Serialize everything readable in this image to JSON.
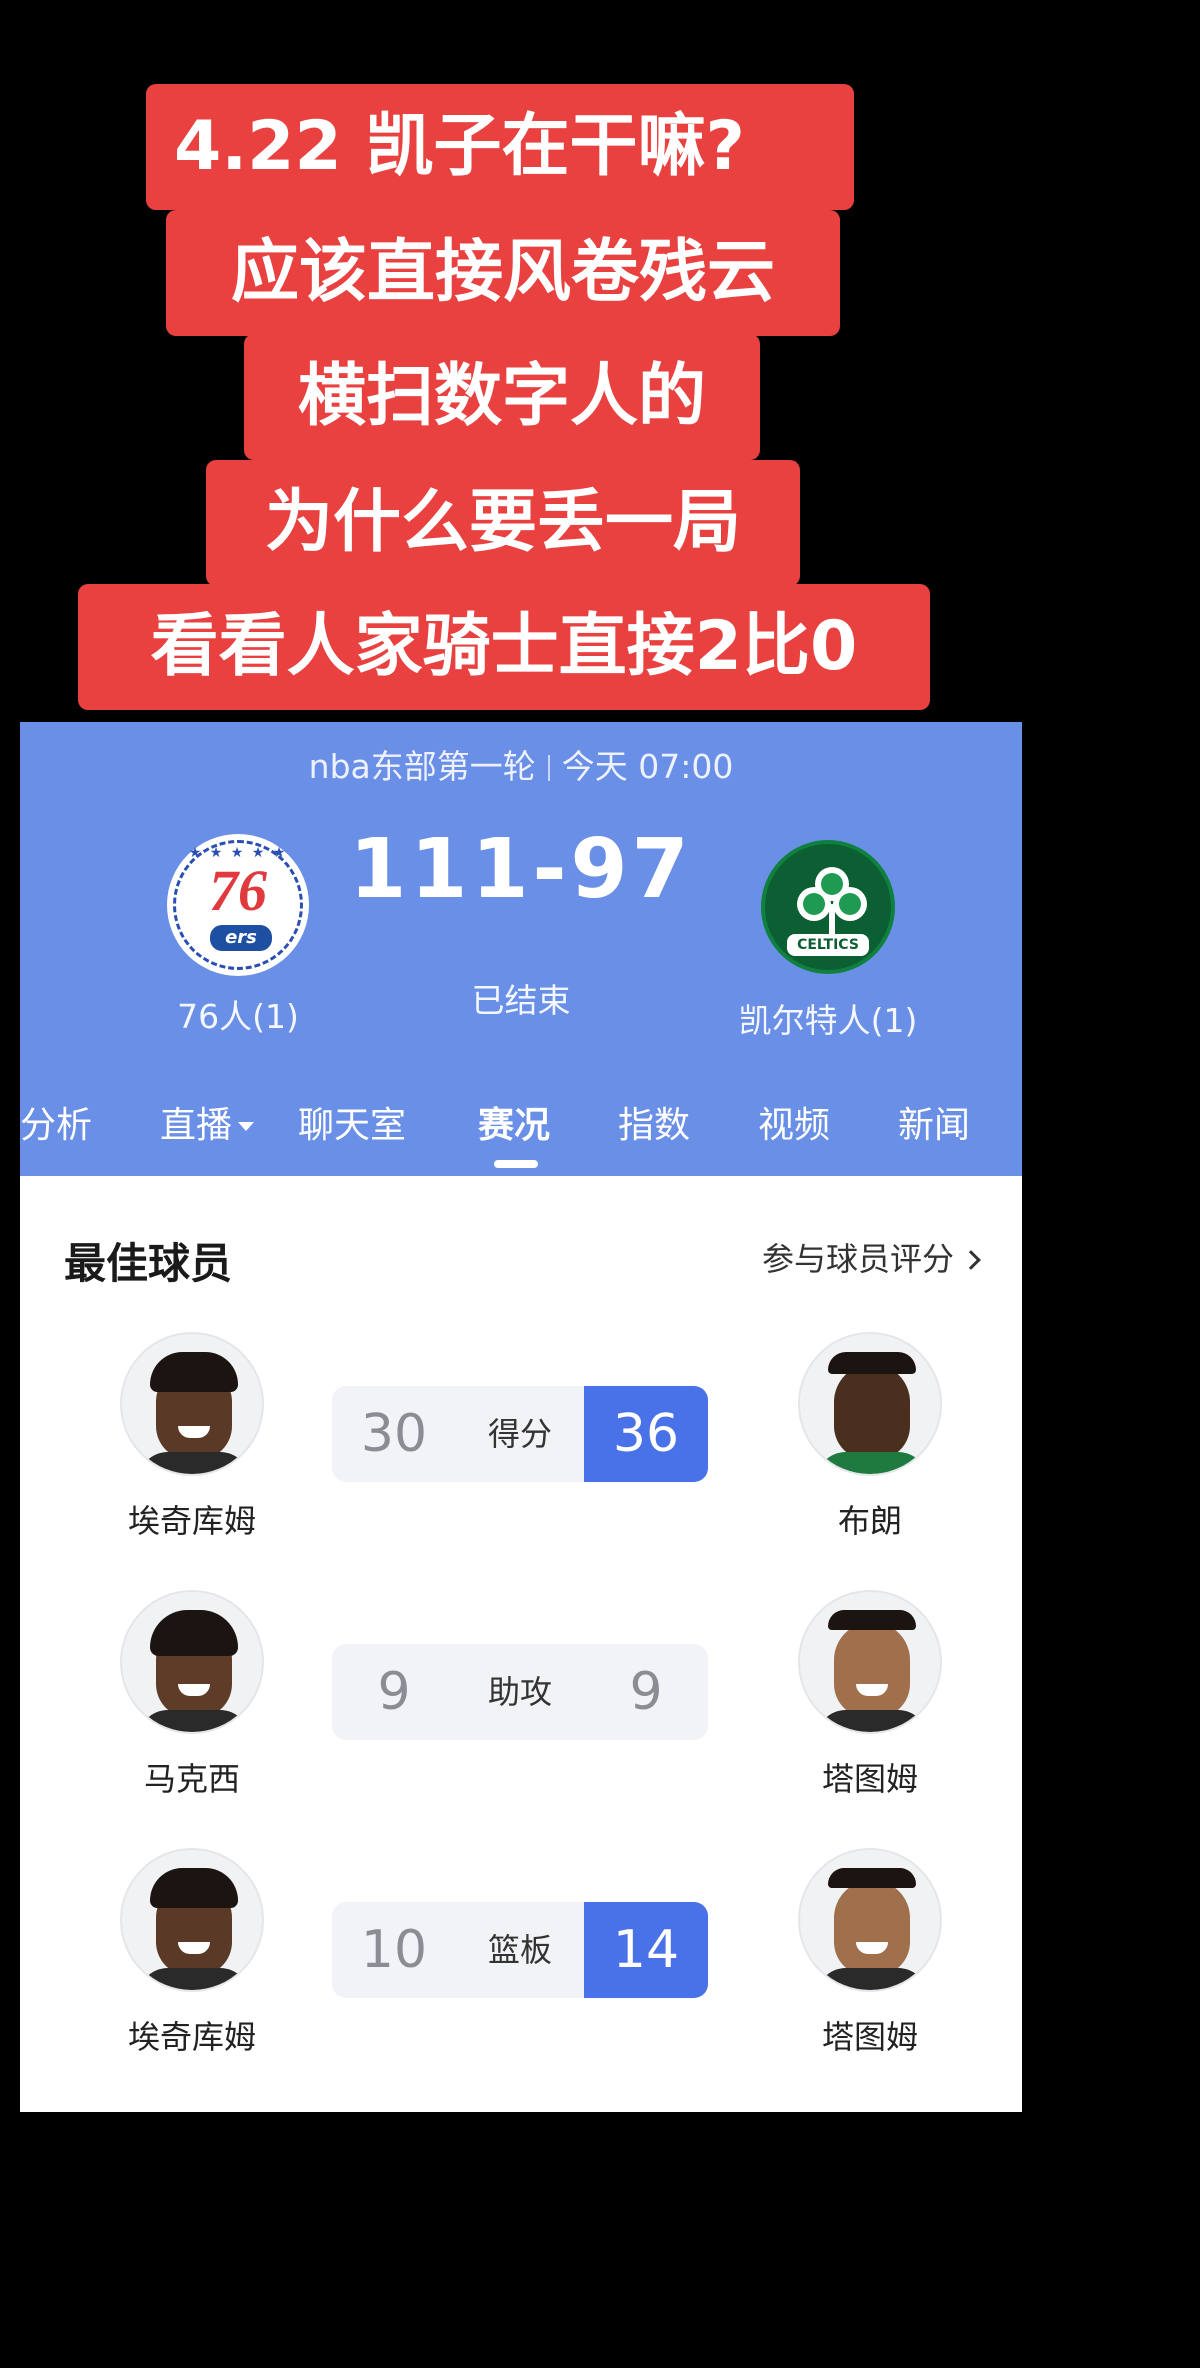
{
  "caption": {
    "lines": [
      "4.22 凯子在干嘛?",
      "应该直接风卷残云",
      "横扫数字人的",
      "为什么要丢一局",
      "看看人家骑士直接2比0"
    ]
  },
  "match": {
    "competition": "nba东部第一轮",
    "time": "今天 07:00",
    "score": "111-97",
    "status": "已结束",
    "home_team": {
      "name": "76人(1)",
      "logo": "76ers-logo",
      "logo_text": "76",
      "logo_sub": "ers"
    },
    "away_team": {
      "name": "凯尔特人(1)",
      "logo": "celtics-logo",
      "logo_text": "CELTICS"
    }
  },
  "tabs": [
    {
      "label": "分析",
      "active": false,
      "has_dropdown": false
    },
    {
      "label": "直播",
      "active": false,
      "has_dropdown": true
    },
    {
      "label": "聊天室",
      "active": false,
      "has_dropdown": false
    },
    {
      "label": "赛况",
      "active": true,
      "has_dropdown": false
    },
    {
      "label": "指数",
      "active": false,
      "has_dropdown": false
    },
    {
      "label": "视频",
      "active": false,
      "has_dropdown": false
    },
    {
      "label": "新闻",
      "active": false,
      "has_dropdown": false
    }
  ],
  "best_players": {
    "title": "最佳球员",
    "rate_link": "参与球员评分",
    "rows": [
      {
        "stat": "得分",
        "left_player": "埃奇库姆",
        "left_value": "30",
        "right_player": "布朗",
        "right_value": "36",
        "winner": "right"
      },
      {
        "stat": "助攻",
        "left_player": "马克西",
        "left_value": "9",
        "right_player": "塔图姆",
        "right_value": "9",
        "winner": "none"
      },
      {
        "stat": "篮板",
        "left_player": "埃奇库姆",
        "left_value": "10",
        "right_player": "塔图姆",
        "right_value": "14",
        "winner": "right"
      }
    ]
  },
  "colors": {
    "caption_bg": "#e8413f",
    "header_bg": "#6a8fe6",
    "stat_highlight": "#4a72e8",
    "celtics_green": "#0b5f32",
    "sixers_red": "#e03a3e",
    "sixers_blue": "#1d4fa3"
  }
}
